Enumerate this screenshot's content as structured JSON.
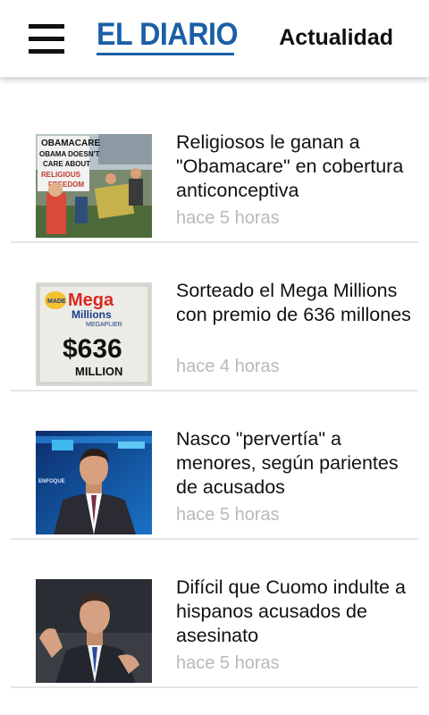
{
  "header": {
    "logo_text": "EL DIARIO",
    "section": "Actualidad"
  },
  "colors": {
    "brand": "#1a5fa6",
    "timestamp": "#b9b9b9",
    "divider": "#e6e6e6"
  },
  "articles": [
    {
      "title": "Religiosos le ganan a \"Obamacare\" en cobertura anticonceptiva",
      "time": "hace 5 horas",
      "image_icon": "protest-photo",
      "image_signs": [
        "OBAMACARE",
        "OBAMA DOESN'T",
        "CARE ABOUT",
        "RELIGIOUS",
        "FREEDOM"
      ]
    },
    {
      "title": "Sorteado el Mega Millions con premio de 636 millones",
      "time": "hace 4 horas",
      "image_icon": "lottery-sign-photo",
      "image_signs": [
        "MADE",
        "Mega",
        "Millions",
        "MEGAPLIER",
        "$636",
        "MILLION"
      ]
    },
    {
      "title": "Nasco \"pervertía\" a menores, según parientes de acusados",
      "time": "hace 5 horas",
      "image_icon": "news-anchor-photo",
      "image_signs": [
        "ENFOQUE"
      ]
    },
    {
      "title": "Difícil que Cuomo indulte a hispanos acusados de asesinato",
      "time": "hace 5 horas",
      "image_icon": "politician-photo",
      "image_signs": []
    }
  ]
}
